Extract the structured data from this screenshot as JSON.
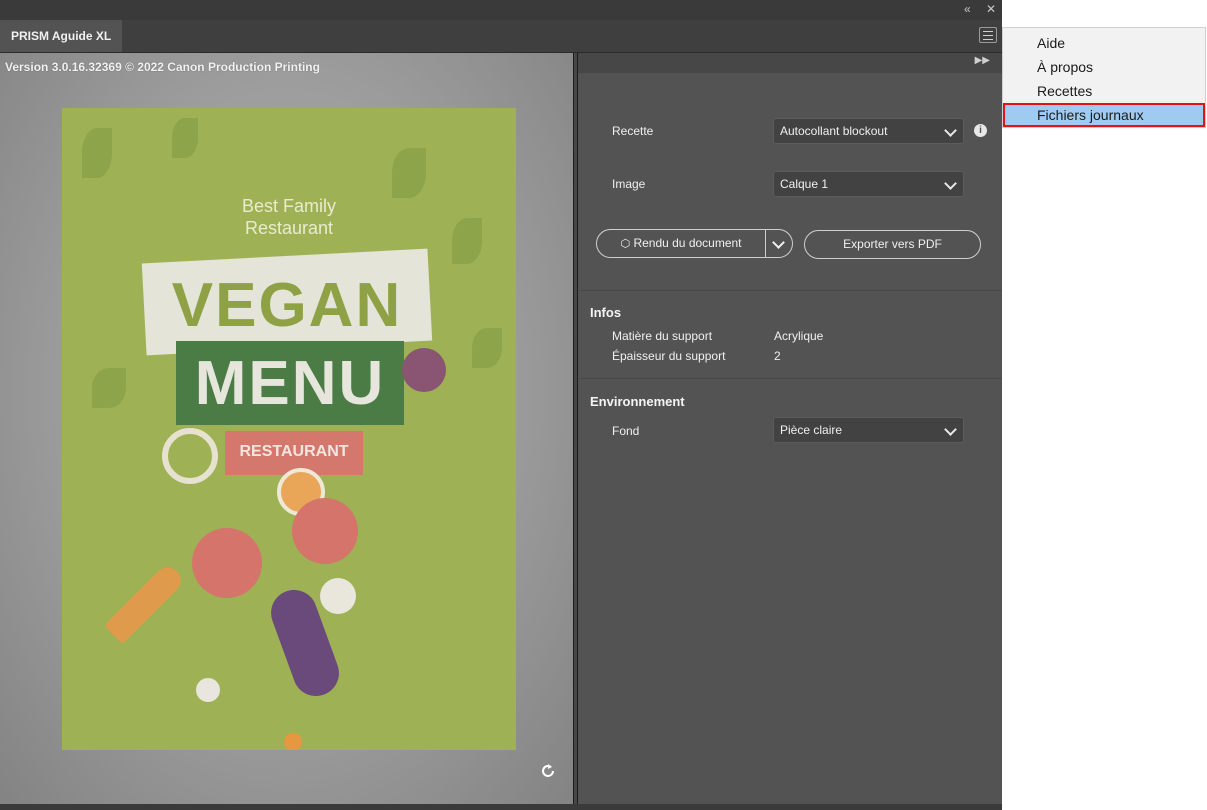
{
  "window": {
    "collapse_icon": "double-chevron-left",
    "close_icon": "close"
  },
  "tab": {
    "title": "PRISM Aguide XL"
  },
  "preview": {
    "version_text": "Version 3.0.16.32369 © 2022 Canon Production Printing",
    "poster": {
      "tagline_line1": "Best Family",
      "tagline_line2": "Restaurant",
      "title_line1": "VEGAN",
      "title_line2": "MENU",
      "subtitle": "RESTAURANT"
    }
  },
  "settings": {
    "recipe_label": "Recette",
    "recipe_value": "Autocollant blockout",
    "image_label": "Image",
    "image_value": "Calque 1",
    "render_button": "Rendu du document",
    "export_button": "Exporter vers PDF",
    "info_title": "Infos",
    "material_label": "Matière du support",
    "material_value": "Acrylique",
    "thickness_label": "Épaisseur du support",
    "thickness_value": "2",
    "environment_title": "Environnement",
    "background_label": "Fond",
    "background_value": "Pièce claire"
  },
  "menu": {
    "items": [
      {
        "label": "Aide"
      },
      {
        "label": "À propos"
      },
      {
        "label": "Recettes"
      },
      {
        "label": "Fichiers journaux",
        "selected": true
      }
    ]
  },
  "colors": {
    "panel_bg": "#535353",
    "selection_bg": "#9fcbf0",
    "highlight_border": "#e01414"
  }
}
